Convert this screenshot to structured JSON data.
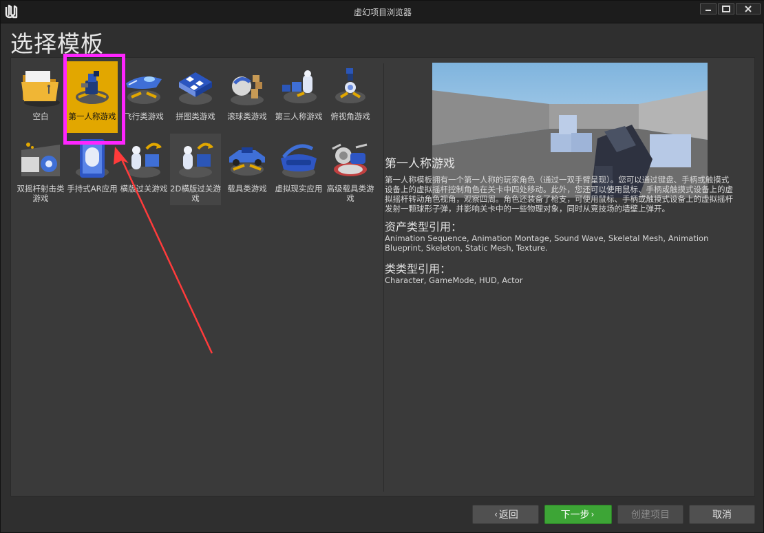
{
  "window": {
    "title": "虚幻项目浏览器"
  },
  "page": {
    "title": "选择模板"
  },
  "templates": [
    {
      "label": "空白"
    },
    {
      "label": "第一人称游戏"
    },
    {
      "label": "飞行类游戏"
    },
    {
      "label": "拼图类游戏"
    },
    {
      "label": "滚球类游戏"
    },
    {
      "label": "第三人称游戏"
    },
    {
      "label": "俯视角游戏"
    },
    {
      "label": "双摇杆射击类游戏"
    },
    {
      "label": "手持式AR应用"
    },
    {
      "label": "横版过关游戏"
    },
    {
      "label": "2D横版过关游戏"
    },
    {
      "label": "载具类游戏"
    },
    {
      "label": "虚拟现实应用"
    },
    {
      "label": "高级载具类游戏"
    }
  ],
  "selected_index": 1,
  "details": {
    "title": "第一人称游戏",
    "description": "第一人称模板拥有一个第一人称的玩家角色（通过一双手臂呈现）。您可以通过键盘、手柄或触摸式设备上的虚拟摇杆控制角色在关卡中四处移动。此外，您还可以使用鼠标、手柄或触摸式设备上的虚拟摇杆转动角色视角，观察四周。角色还装备了枪支，可使用鼠标、手柄或触摸式设备上的虚拟摇杆发射一颗球形子弹，并影响关卡中的一些物理对象，同时从竞技场的墙壁上弹开。",
    "assets_heading": "资产类型引用：",
    "assets": "Animation Sequence, Animation Montage, Sound Wave, Skeletal Mesh, Animation Blueprint, Skeleton, Static Mesh, Texture.",
    "classes_heading": "类类型引用：",
    "classes": "Character, GameMode, HUD, Actor"
  },
  "buttons": {
    "back": "返回",
    "next": "下一步",
    "create": "创建项目",
    "cancel": "取消"
  },
  "colors": {
    "selected": "#e2a700",
    "highlight": "#ff25ff",
    "arrow": "#ff3b3b",
    "next_button": "#3da536"
  }
}
